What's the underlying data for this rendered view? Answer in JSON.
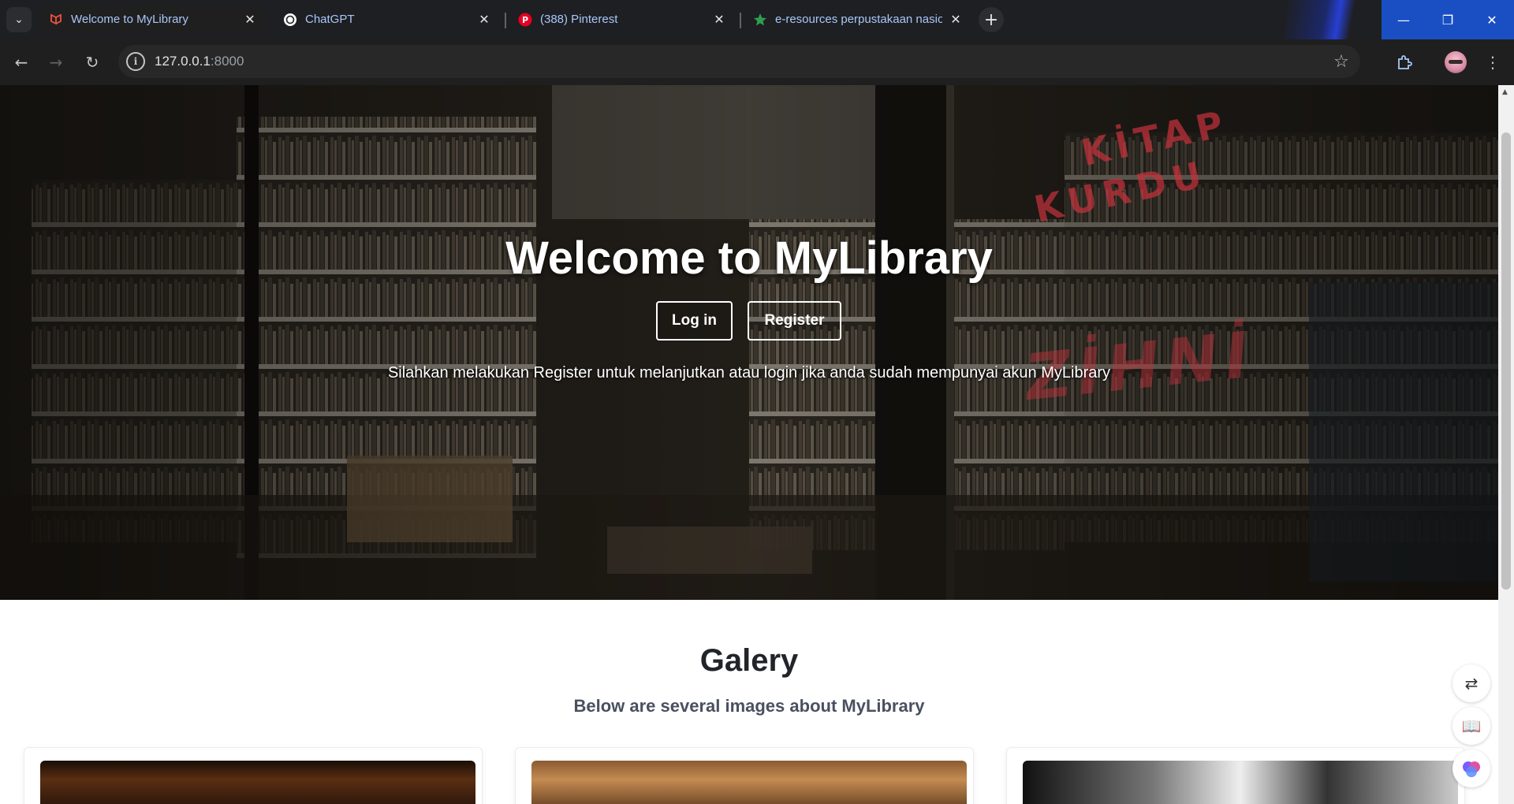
{
  "browser": {
    "tabs": [
      {
        "title": "Welcome to MyLibrary",
        "icon": "laravel-icon",
        "active": true
      },
      {
        "title": "ChatGPT",
        "icon": "chatgpt-icon",
        "active": false
      },
      {
        "title": "(388) Pinterest",
        "icon": "pinterest-icon",
        "active": false
      },
      {
        "title": "e-resources perpustakaan nasio",
        "icon": "star-favicon-icon",
        "active": false
      }
    ],
    "url_host": "127.0.0.1",
    "url_port": ":8000",
    "accent_color": "#1a4fc4"
  },
  "hero": {
    "title": "Welcome to MyLibrary",
    "login_label": "Log in",
    "register_label": "Register",
    "subtitle": "Silahkan melakukan Register untuk melanjutkan atau login jika anda sudah mempunyai akun MyLibrary"
  },
  "gallery": {
    "title": "Galery",
    "subtitle": "Below are several images about MyLibrary"
  }
}
